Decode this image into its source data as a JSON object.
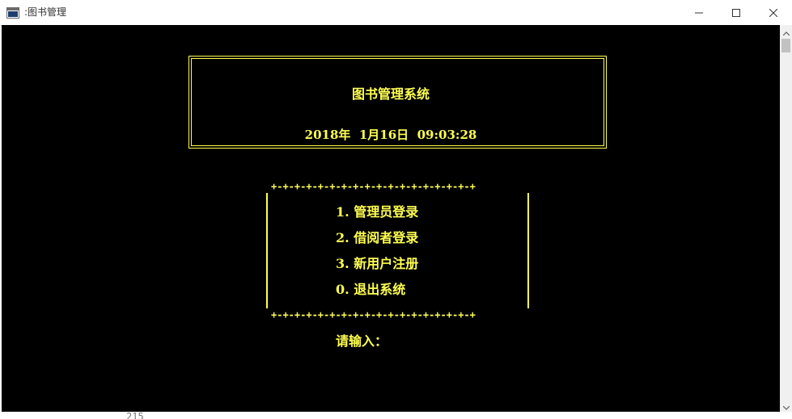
{
  "window": {
    "title": ":图书管理",
    "controls": {
      "minimize_icon": "minimize-icon",
      "maximize_icon": "maximize-icon",
      "close_icon": "close-icon"
    }
  },
  "console": {
    "system_title": "图书管理系统",
    "datetime": "2018年  1月16日  09:03:28",
    "menu_border_top": "+-+-+-+-+-+-+-+-+-+-+-+-+-+-+-+-+-+",
    "menu_border_bottom": "+-+-+-+-+-+-+-+-+-+-+-+-+-+-+-+-+-+",
    "menu_items": [
      {
        "label": "1. 管理员登录"
      },
      {
        "label": "2. 借阅者登录"
      },
      {
        "label": "3. 新用户注册"
      },
      {
        "label": "0. 退出系统"
      }
    ],
    "prompt": "请输入：",
    "text_color": "#ffff4f",
    "background_color": "#000000"
  },
  "behind_window_text": "215"
}
